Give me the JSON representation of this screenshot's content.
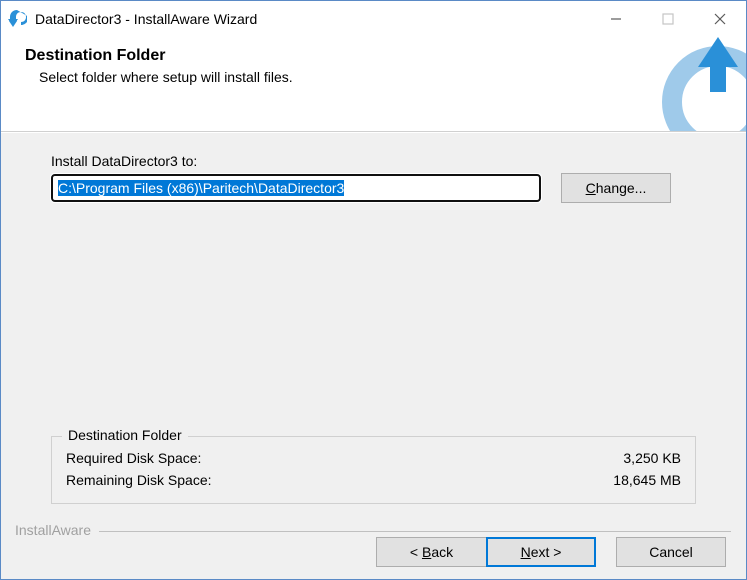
{
  "window": {
    "title": "DataDirector3 - InstallAware Wizard"
  },
  "header": {
    "title": "Destination Folder",
    "subtitle": "Select folder where setup will install files."
  },
  "body": {
    "install_to_label": "Install DataDirector3 to:",
    "install_path": "C:\\Program Files (x86)\\Paritech\\DataDirector3",
    "change_button_prefix": "C",
    "change_button_rest": "hange..."
  },
  "groupbox": {
    "legend": "Destination Folder",
    "required_label": "Required Disk Space:",
    "required_value": "3,250 KB",
    "remaining_label": "Remaining Disk Space:",
    "remaining_value": "18,645 MB"
  },
  "footer": {
    "brand": "InstallAware",
    "back_prefix": "< ",
    "back_u": "B",
    "back_rest": "ack",
    "next_u": "N",
    "next_rest": "ext >",
    "cancel": "Cancel"
  }
}
